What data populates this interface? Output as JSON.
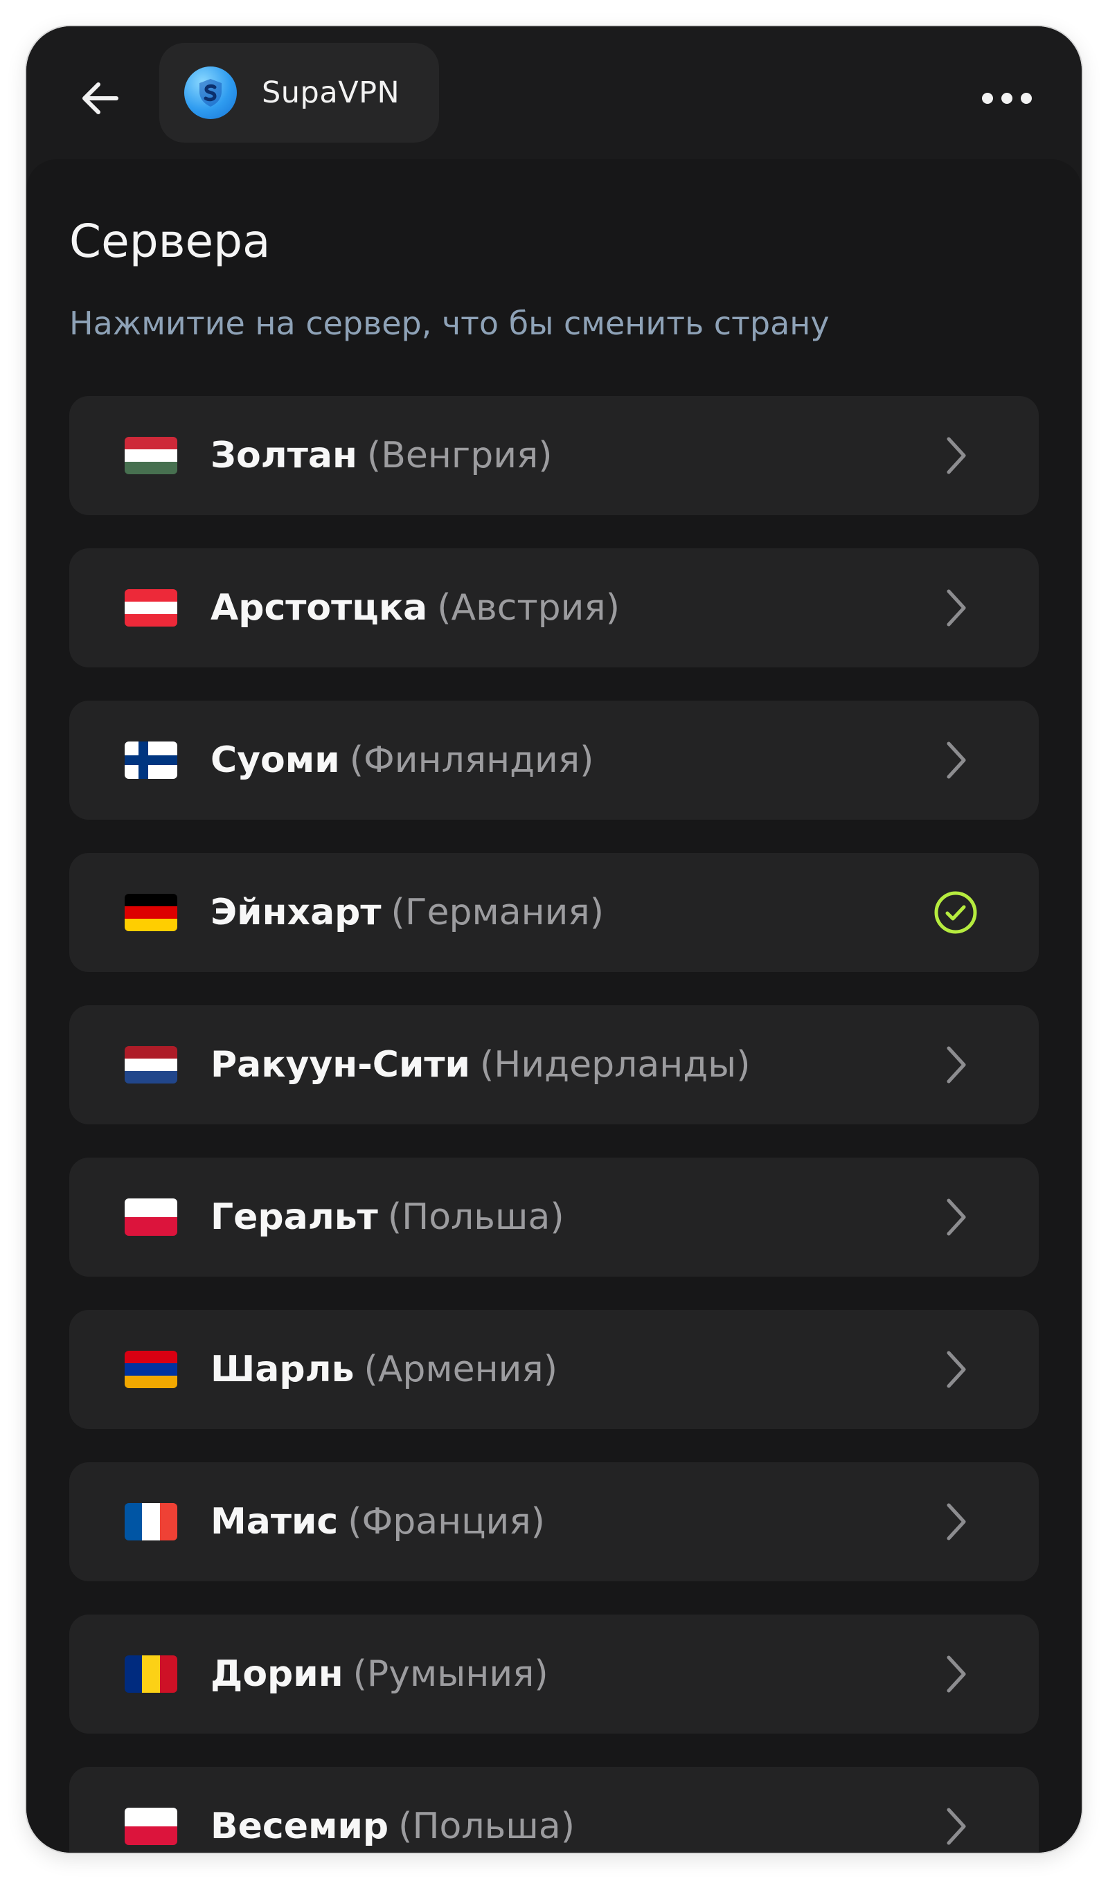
{
  "header": {
    "back_icon": "arrow-left-icon",
    "app_name": "SupaVPN",
    "app_logo_icon": "shield-logo-icon",
    "more_icon": "more-horizontal-icon"
  },
  "page": {
    "title": "Сервера",
    "subtitle": "Нажмитие на сервер, что бы сменить страну"
  },
  "colors": {
    "background": "#171718",
    "card": "#232324",
    "subtitle": "#8ea2b7",
    "selected_check": "#b6ec3f",
    "chevron": "#8d8d90"
  },
  "servers": [
    {
      "name": "Золтан",
      "country": "(Венгрия)",
      "flag": "hungary",
      "selected": false
    },
    {
      "name": "Арстотцка",
      "country": "(Австрия)",
      "flag": "austria",
      "selected": false
    },
    {
      "name": "Суоми",
      "country": "(Финляндия)",
      "flag": "finland",
      "selected": false
    },
    {
      "name": "Эйнхарт",
      "country": "(Германия)",
      "flag": "germany",
      "selected": true
    },
    {
      "name": "Ракуун-Сити",
      "country": "(Нидерланды)",
      "flag": "netherlands",
      "selected": false
    },
    {
      "name": "Геральт",
      "country": "(Польша)",
      "flag": "poland",
      "selected": false
    },
    {
      "name": "Шарль",
      "country": "(Армения)",
      "flag": "armenia",
      "selected": false
    },
    {
      "name": "Матис",
      "country": "(Франция)",
      "flag": "france",
      "selected": false
    },
    {
      "name": "Дорин",
      "country": "(Румыния)",
      "flag": "romania",
      "selected": false
    },
    {
      "name": "Весемир",
      "country": "(Польша)",
      "flag": "poland",
      "selected": false
    }
  ]
}
